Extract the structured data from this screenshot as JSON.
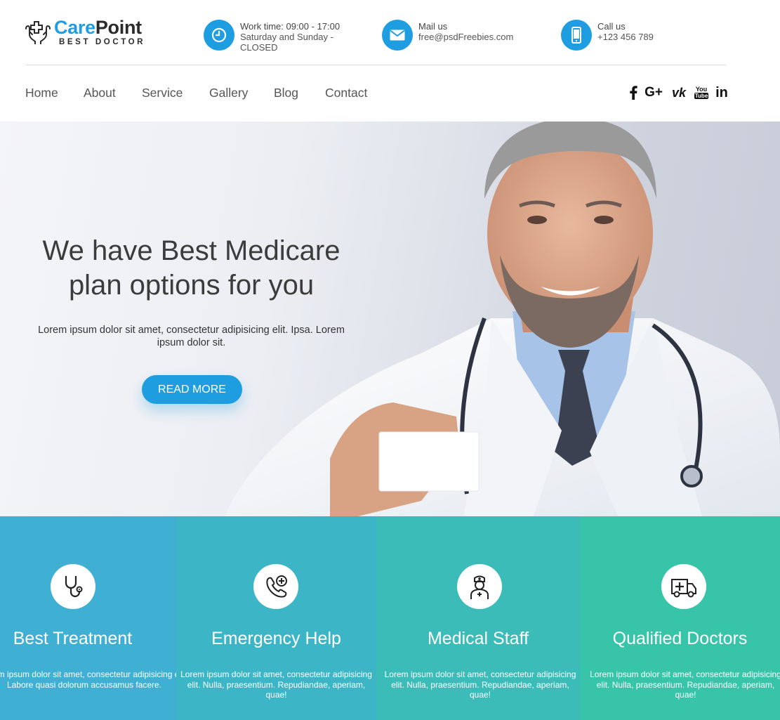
{
  "brand": {
    "name_part1": "Care",
    "name_part2": "Point",
    "tagline": "BEST DOCTOR",
    "primary_color": "#1e9ee0"
  },
  "contact": [
    {
      "icon": "clock-icon",
      "label": "Work time: 09:00 - 17:00",
      "value": "Saturday and Sunday - CLOSED"
    },
    {
      "icon": "envelope-icon",
      "label": "Mail us",
      "value": "free@psdFreebies.com"
    },
    {
      "icon": "phone-icon",
      "label": "Call us",
      "value": "+123 456 789"
    }
  ],
  "nav": {
    "items": [
      "Home",
      "About",
      "Service",
      "Gallery",
      "Blog",
      "Contact"
    ]
  },
  "social": [
    "facebook-icon",
    "google-plus-icon",
    "vk-icon",
    "youtube-icon",
    "linkedin-icon"
  ],
  "social_labels": {
    "google": "G+",
    "vk": "vk",
    "youtube_top": "You",
    "youtube_bottom": "Tube",
    "linkedin": "in"
  },
  "hero": {
    "title_line1": "We have Best Medicare",
    "title_line2": "plan options for you",
    "text": "Lorem ipsum dolor sit amet, consectetur adipisicing elit. Ipsa. Lorem ipsum dolor sit.",
    "button": "READ MORE"
  },
  "features": [
    {
      "icon": "stethoscope-icon",
      "title": "Best Treatment",
      "text": "Lorem ipsum dolor sit amet, consectetur adipisicing elit. Labore quasi dolorum accusamus facere.",
      "color": "#3fb0d3"
    },
    {
      "icon": "phone-medical-icon",
      "title": "Emergency Help",
      "text": "Lorem ipsum dolor sit amet, consectetur adipisicing elit. Nulla, praesentium. Repudiandae, aperiam, quae!",
      "color": "#3cb6c6"
    },
    {
      "icon": "nurse-icon",
      "title": "Medical Staff",
      "text": "Lorem ipsum dolor sit amet, consectetur adipisicing elit. Nulla, praesentium. Repudiandae, aperiam, quae!",
      "color": "#3bbcb8"
    },
    {
      "icon": "ambulance-icon",
      "title": "Qualified Doctors",
      "text": "Lorem ipsum dolor sit amet, consectetur adipisicing elit. Nulla, praesentium. Repudiandae, aperiam, quae!",
      "color": "#38c4a9"
    }
  ]
}
